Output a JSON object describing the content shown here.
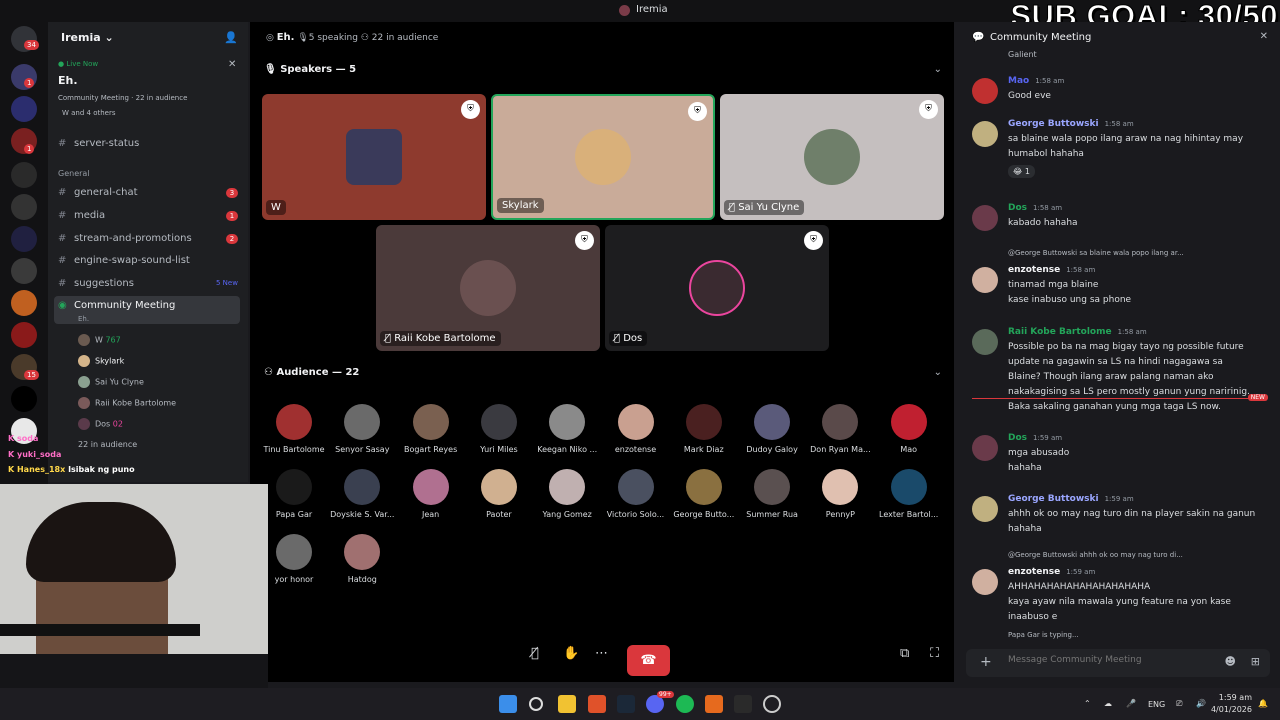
{
  "window": {
    "title": "Iremia",
    "overlay": "SUB GOAL: 30/50"
  },
  "server": {
    "name": "Iremia",
    "live_label": "Live Now",
    "voice_channel": "Eh.",
    "voice_sub": "Community Meeting · 22 in audience",
    "voice_users": "W and 4 others",
    "channels": [
      {
        "label": "server-status",
        "badge": ""
      },
      {
        "label": "general-chat",
        "badge": "3"
      },
      {
        "label": "media",
        "badge": "1"
      },
      {
        "label": "stream-and-promotions",
        "badge": "2"
      },
      {
        "label": "engine-swap-sound-list",
        "badge": ""
      },
      {
        "label": "suggestions",
        "badge": "5 New"
      }
    ],
    "category": "General",
    "active_channel": "Community Meeting",
    "active_channel_sub": "Eh.",
    "stage_members": [
      {
        "name": "W",
        "tag": "767"
      },
      {
        "name": "Skylark",
        "tag": ""
      },
      {
        "name": "Sai Yu Clyne",
        "tag": ""
      },
      {
        "name": "Raii Kobe Bartolome",
        "tag": ""
      },
      {
        "name": "Dos",
        "tag": "02"
      }
    ],
    "in_audience": "22 in audience",
    "rail_badges": [
      "34",
      "1",
      "1",
      "15"
    ]
  },
  "stage": {
    "topic": "Eh.",
    "speaking": "5 speaking",
    "audience_count": "22 in audience",
    "speakers_title": "Speakers — 5",
    "speakers": [
      {
        "name": "W",
        "color": "#8e3a2e"
      },
      {
        "name": "Skylark",
        "color": "#c9ab99"
      },
      {
        "name": "Sai Yu Clyne",
        "color": "#c5bfbf"
      },
      {
        "name": "Raii Kobe Bartolome",
        "color": "#4b3a3a"
      },
      {
        "name": "Dos",
        "color": "#1d1d1f"
      }
    ],
    "audience_title": "Audience — 22",
    "audience": [
      "Tinu Bartolome",
      "Senyor Sasay",
      "Bogart Reyes",
      "Yuri Miles",
      "Keegan Niko ...",
      "enzotense",
      "Mark Diaz",
      "Dudoy Galoy",
      "Don Ryan Ma...",
      "Mao",
      "Papa Gar",
      "Doyskie S. Var...",
      "Jean",
      "Paoter",
      "Yang Gomez",
      "Victorio Solo...",
      "George Butto...",
      "Summer Rua",
      "PennyP",
      "Lexter Bartol...",
      "yor honor",
      "Hatdog"
    ]
  },
  "chat": {
    "title": "Community Meeting",
    "top_fragment": "Galient",
    "messages": [
      {
        "author": "Mao",
        "time": "1:58 am",
        "lines": [
          "Good eve"
        ],
        "color": "#5865f2"
      },
      {
        "author": "George Buttowski",
        "time": "1:58 am",
        "lines": [
          "sa blaine wala popo ilang araw na nag hihintay may",
          "humabol hahaha"
        ],
        "color": "#9aa6ff"
      },
      {
        "author": "Dos",
        "time": "1:58 am",
        "lines": [
          "kabado hahaha"
        ],
        "color": "#23a55a"
      },
      {
        "author": "enzotense",
        "time": "1:58 am",
        "reply": "@George Buttowski  sa blaine wala popo ilang ar...",
        "lines": [
          "tinamad mga blaine",
          "kase inabuso ung sa phone"
        ],
        "color": "#f2f3f5"
      },
      {
        "author": "Raii Kobe Bartolome",
        "time": "1:58 am",
        "lines": [
          "Possible po ba na mag bigay tayo ng possible future",
          "update na gagawin sa LS na hindi nagagawa sa",
          "Blaine? Though ilang araw palang naman ako",
          "nakakagising sa LS pero mostly ganun yung naririnig.",
          "Baka sakaling ganahan yung mga taga LS now."
        ],
        "color": "#23a55a"
      },
      {
        "author": "Dos",
        "time": "1:59 am",
        "lines": [
          "mga abusado",
          "hahaha"
        ],
        "color": "#23a55a"
      },
      {
        "author": "George Buttowski",
        "time": "1:59 am",
        "lines": [
          "ahhh ok oo may nag turo din na player sakin na ganun",
          "hahaha"
        ],
        "color": "#9aa6ff"
      },
      {
        "author": "enzotense",
        "time": "1:59 am",
        "reply": "@George Buttowski  ahhh ok oo may nag turo di...",
        "lines": [
          "AHHAHAHAHAHAHAHAHAHAHA",
          "kaya ayaw nila mawala yung feature na yon kase",
          "inaabuso e"
        ],
        "color": "#f2f3f5"
      }
    ],
    "reaction": "1",
    "new_label": "NEW",
    "typing": "Papa Gar is typing...",
    "input_placeholder": "Message Community Meeting"
  },
  "ticker": [
    "soda",
    "yuki_soda",
    "Hanes_18x",
    "Isibak ng puno"
  ],
  "taskbar": {
    "lang": "ENG",
    "time": "1:59 am",
    "date": "4/01/2026",
    "notif": "99+"
  }
}
